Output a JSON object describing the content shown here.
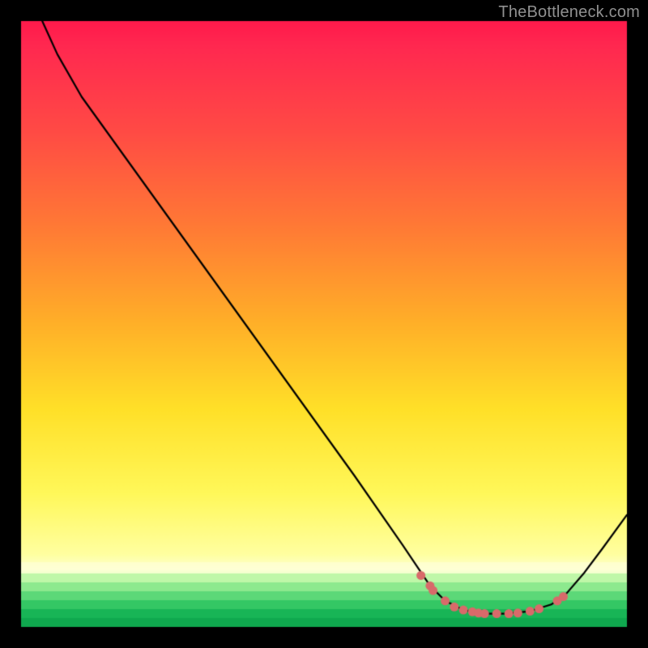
{
  "watermark": "TheBottleneck.com",
  "chart_data": {
    "type": "line",
    "title": "",
    "xlabel": "",
    "ylabel": "",
    "xlim": [
      0,
      100
    ],
    "ylim": [
      0,
      100
    ],
    "gradient_top": "#ff1a4b",
    "gradient_mid1": "#ff8a2a",
    "gradient_mid2": "#ffe22a",
    "gradient_low": "#ffff8a",
    "gradient_green_top": "#d6ffb0",
    "gradient_green_mid": "#56d67a",
    "gradient_green_bot": "#0fa84e",
    "line_color": "#000000",
    "dot_color": "#d86a6a",
    "curve": [
      {
        "x": 3.5,
        "y": 100.0
      },
      {
        "x": 6.0,
        "y": 94.5
      },
      {
        "x": 10.0,
        "y": 87.5
      },
      {
        "x": 19.0,
        "y": 75.0
      },
      {
        "x": 28.0,
        "y": 62.5
      },
      {
        "x": 37.0,
        "y": 50.0
      },
      {
        "x": 46.0,
        "y": 37.5
      },
      {
        "x": 55.0,
        "y": 25.0
      },
      {
        "x": 63.0,
        "y": 13.5
      },
      {
        "x": 67.5,
        "y": 6.8
      },
      {
        "x": 70.0,
        "y": 4.3
      },
      {
        "x": 73.0,
        "y": 2.8
      },
      {
        "x": 76.0,
        "y": 2.2
      },
      {
        "x": 80.0,
        "y": 2.2
      },
      {
        "x": 84.0,
        "y": 2.6
      },
      {
        "x": 87.5,
        "y": 3.7
      },
      {
        "x": 90.0,
        "y": 5.5
      },
      {
        "x": 93.0,
        "y": 9.0
      },
      {
        "x": 96.0,
        "y": 13.0
      },
      {
        "x": 100.0,
        "y": 18.5
      }
    ],
    "dots": [
      {
        "x": 66.0,
        "y": 8.5
      },
      {
        "x": 67.5,
        "y": 6.8
      },
      {
        "x": 68.0,
        "y": 6.0
      },
      {
        "x": 70.0,
        "y": 4.3
      },
      {
        "x": 71.5,
        "y": 3.3
      },
      {
        "x": 73.0,
        "y": 2.8
      },
      {
        "x": 74.5,
        "y": 2.5
      },
      {
        "x": 75.5,
        "y": 2.3
      },
      {
        "x": 76.5,
        "y": 2.2
      },
      {
        "x": 78.5,
        "y": 2.2
      },
      {
        "x": 80.5,
        "y": 2.2
      },
      {
        "x": 82.0,
        "y": 2.3
      },
      {
        "x": 84.0,
        "y": 2.6
      },
      {
        "x": 85.5,
        "y": 3.0
      },
      {
        "x": 88.5,
        "y": 4.3
      },
      {
        "x": 89.5,
        "y": 5.0
      }
    ]
  }
}
